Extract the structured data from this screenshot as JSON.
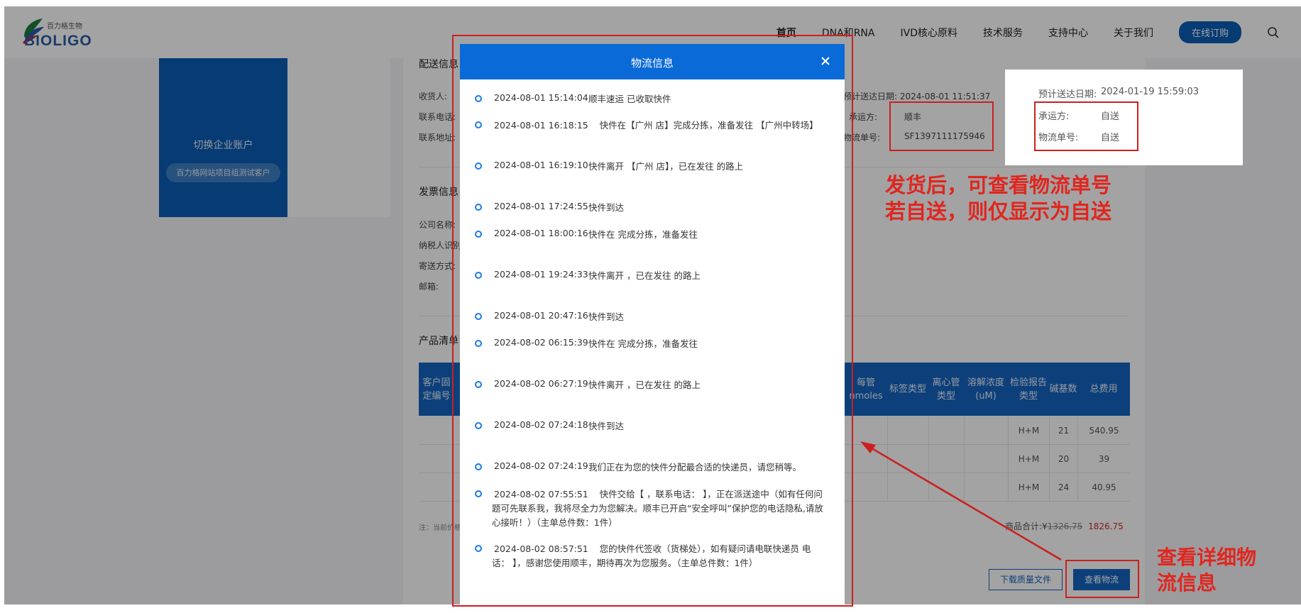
{
  "header": {
    "logo_cn": "百力格生物",
    "logo_en": "BIOLIGO",
    "nav": [
      "首页",
      "DNA和RNA",
      "IVD核心原料",
      "技术服务",
      "支持中心",
      "关于我们"
    ],
    "order_button": "在线订购"
  },
  "sidebar": {
    "switch_label": "切换企业账户",
    "company_name": "百力格网站项目组测试客户"
  },
  "delivery": {
    "title": "配送信息",
    "receiver_label": "收货人:",
    "phone_label": "联系电话:",
    "address_label": "联系地址:",
    "eta_label": "预计送达日期: 2024-08-01 11:51:37",
    "carrier_label": "承运方:",
    "carrier_value": "顺丰",
    "tracking_label": "物流单号:",
    "tracking_value": "SF1397111175946"
  },
  "invoice": {
    "title": "发票信息",
    "company_label": "公司名称:",
    "taxpayer_label": "纳税人识别号:",
    "shipping_label": "寄送方式:",
    "email_label": "邮箱:"
  },
  "products": {
    "title": "产品清单",
    "headers": [
      "客户固定编号",
      "每管 nmoles",
      "标签类型",
      "离心管类型",
      "溶解浓度 (uM)",
      "检验报告类型",
      "碱基数",
      "总费用"
    ],
    "rows": [
      {
        "report": "H+M",
        "bases": "21",
        "total": "540.95"
      },
      {
        "report": "H+M",
        "bases": "20",
        "total": "39"
      },
      {
        "report": "H+M",
        "bases": "24",
        "total": "40.95"
      }
    ],
    "note": "注：当前价格",
    "sum_label": "商品合计:¥",
    "sum_original": "1326.75",
    "sum_final": "1826.75",
    "download_button": "下载质量文件",
    "logistics_button": "查看物流"
  },
  "popup": {
    "eta_label": "预计送达日期:",
    "eta_value": "2024-01-19 15:59:03",
    "carrier_label": "承运方:",
    "carrier_value": "自送",
    "tracking_label": "物流单号:",
    "tracking_value": "自送"
  },
  "modal": {
    "title": "物流信息",
    "events": [
      {
        "time": "2024-08-01 15:14:04",
        "text": "顺丰速运 已收取快件"
      },
      {
        "time": "2024-08-01 16:18:15",
        "text": "快件在【广州           店】完成分拣，准备发往 【广州中转场】"
      },
      {
        "time": "2024-08-01 16:19:10",
        "text": "快件离开 【广州           店】，已在发往       的路上"
      },
      {
        "time": "2024-08-01 17:24:55",
        "text": "快件到达"
      },
      {
        "time": "2024-08-01 18:00:16",
        "text": "快件在                           完成分拣，准备发往"
      },
      {
        "time": "2024-08-01 19:24:33",
        "text": "快件离开                           ，已在发往       的路上"
      },
      {
        "time": "2024-08-01 20:47:16",
        "text": "快件到达"
      },
      {
        "time": "2024-08-02 06:15:39",
        "text": "快件在                           完成分拣，准备发往"
      },
      {
        "time": "2024-08-02 06:27:19",
        "text": "快件离开                           ，已在发往       的路上"
      },
      {
        "time": "2024-08-02 07:24:18",
        "text": "快件到达"
      },
      {
        "time": "2024-08-02 07:24:19",
        "text": "我们正在为您的快件分配最合适的快递员，请您稍等。"
      },
      {
        "time": "2024-08-02 07:55:51",
        "text": "快件交给【          ，联系电话：                  】，正在派送途中（如有任何问题可先联系我，我将尽全力为您解决。顺丰已开启“安全呼叫”保护您的电话隐私,请放心接听！）（主单总件数：1件）"
      },
      {
        "time": "2024-08-02 08:57:51",
        "text": "您的快件代签收（货梯处），如有疑问请电联快递员        电话：                  】，感谢您使用顺丰，期待再次为您服务。（主单总件数：1件）"
      }
    ]
  },
  "annotations": {
    "note_line1": "发货后，可查看物流单号",
    "note_line2": "若自送，则仅显示为自送",
    "view_line1": "查看详细物",
    "view_line2": "流信息",
    "color": "#e0261f"
  }
}
